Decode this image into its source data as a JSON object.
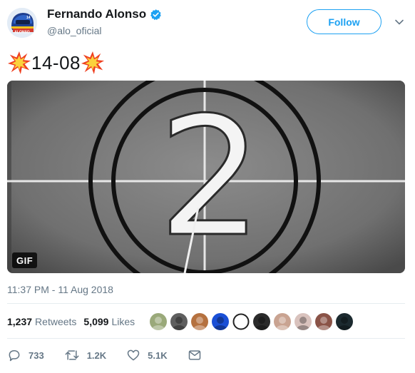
{
  "author": {
    "display_name": "Fernando Alonso",
    "handle": "@alo_oficial",
    "verified": true,
    "avatar_text": "ALONSO",
    "avatar_number": "14"
  },
  "follow_label": "Follow",
  "tweet": {
    "text": "14-08",
    "emoji_left": "collision-icon",
    "emoji_right": "collision-icon"
  },
  "media": {
    "badge": "GIF",
    "digit": "2"
  },
  "timestamp": "11:37 PM - 11 Aug 2018",
  "stats": {
    "retweets_count": "1,237",
    "retweets_label": "Retweets",
    "likes_count": "5,099",
    "likes_label": "Likes"
  },
  "likers": [
    {
      "name": "liker-avatar-1",
      "color": "#9aa97a"
    },
    {
      "name": "liker-avatar-2",
      "color": "#5f5f5f"
    },
    {
      "name": "liker-avatar-3",
      "color": "#b5713f"
    },
    {
      "name": "liker-avatar-4",
      "color": "#1a4fd6"
    },
    {
      "name": "liker-avatar-5",
      "color": "#ffffff"
    },
    {
      "name": "liker-avatar-6",
      "color": "#2b2b2b"
    },
    {
      "name": "liker-avatar-7",
      "color": "#c9a391"
    },
    {
      "name": "liker-avatar-8",
      "color": "#d9c2bd"
    },
    {
      "name": "liker-avatar-9",
      "color": "#8a5347"
    },
    {
      "name": "liker-avatar-10",
      "color": "#1c2a2f"
    }
  ],
  "actions": {
    "reply_count": "733",
    "retweet_count": "1.2K",
    "like_count": "5.1K"
  },
  "colors": {
    "accent": "#1da1f2",
    "secondary_text": "#657786",
    "border": "#e6ecf0"
  }
}
